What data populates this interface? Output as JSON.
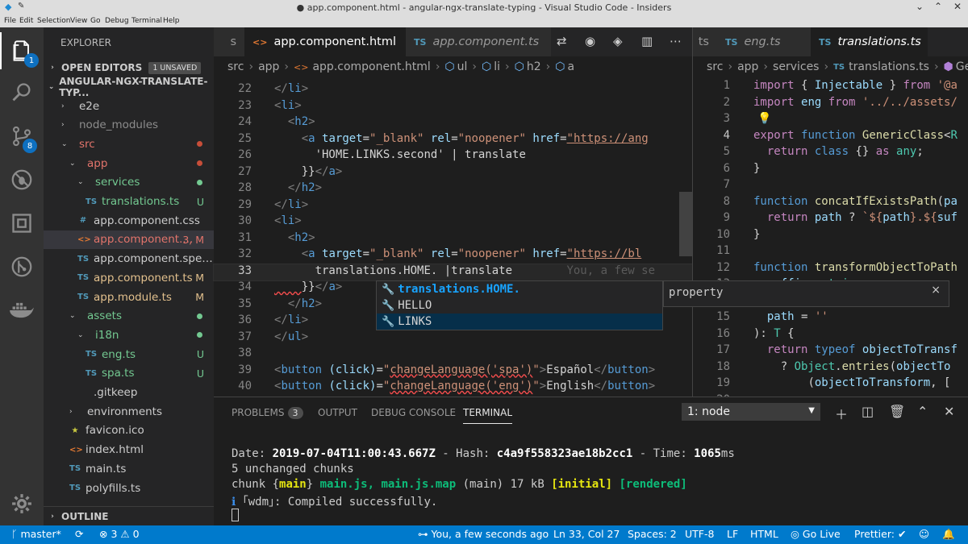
{
  "titlebar": {
    "title": "● app.component.html - angular-ngx-translate-typing - Visual Studio Code - Insiders"
  },
  "menubar": [
    "File",
    "Edit",
    "Selection",
    "View",
    "Go",
    "Debug",
    "Terminal",
    "Help"
  ],
  "activity": {
    "explorer_badge": "1",
    "scm_badge": "8"
  },
  "sidebar": {
    "header": "EXPLORER",
    "open_editors": "OPEN EDITORS",
    "unsaved": "1 UNSAVED",
    "project": "ANGULAR-NGX-TRANSLATE-TYP...",
    "outline": "OUTLINE",
    "items": [
      {
        "label": "e2e",
        "icon": "›",
        "ind": 0,
        "color": "#cccccc",
        "status": "",
        "dot": ""
      },
      {
        "label": "node_modules",
        "icon": "›",
        "ind": 0,
        "color": "#8c8c8c",
        "status": "",
        "dot": ""
      },
      {
        "label": "src",
        "icon": "⌄",
        "ind": 0,
        "color": "#e2746b",
        "status": "",
        "dot": "#c74e39"
      },
      {
        "label": "app",
        "icon": "⌄",
        "ind": 1,
        "color": "#e2746b",
        "status": "",
        "dot": "#c74e39"
      },
      {
        "label": "services",
        "icon": "⌄",
        "ind": 2,
        "color": "#73c991",
        "status": "",
        "dot": "#73c991"
      },
      {
        "label": "translations.ts",
        "icon": "TS",
        "ind": 3,
        "color": "#73c991",
        "status": "U",
        "dot": ""
      },
      {
        "label": "app.component.css",
        "icon": "#",
        "ind": 2,
        "color": "#cccccc",
        "status": "",
        "dot": ""
      },
      {
        "label": "app.component....",
        "icon": "<>",
        "ind": 2,
        "color": "#e2746b",
        "status": "3, M",
        "dot": ""
      },
      {
        "label": "app.component.spec.ts",
        "icon": "TS",
        "ind": 2,
        "color": "#cccccc",
        "status": "",
        "dot": ""
      },
      {
        "label": "app.component.ts",
        "icon": "TS",
        "ind": 2,
        "color": "#e2c08d",
        "status": "M",
        "dot": ""
      },
      {
        "label": "app.module.ts",
        "icon": "TS",
        "ind": 2,
        "color": "#e2c08d",
        "status": "M",
        "dot": ""
      },
      {
        "label": "assets",
        "icon": "⌄",
        "ind": 1,
        "color": "#73c991",
        "status": "",
        "dot": "#73c991"
      },
      {
        "label": "i18n",
        "icon": "⌄",
        "ind": 2,
        "color": "#73c991",
        "status": "",
        "dot": "#73c991"
      },
      {
        "label": "eng.ts",
        "icon": "TS",
        "ind": 3,
        "color": "#73c991",
        "status": "U",
        "dot": ""
      },
      {
        "label": "spa.ts",
        "icon": "TS",
        "ind": 3,
        "color": "#73c991",
        "status": "U",
        "dot": ""
      },
      {
        "label": ".gitkeep",
        "icon": "",
        "ind": 2,
        "color": "#cccccc",
        "status": "",
        "dot": ""
      },
      {
        "label": "environments",
        "icon": "›",
        "ind": 1,
        "color": "#cccccc",
        "status": "",
        "dot": ""
      },
      {
        "label": "favicon.ico",
        "icon": "★",
        "ind": 1,
        "color": "#cccccc",
        "status": "",
        "dot": ""
      },
      {
        "label": "index.html",
        "icon": "<>",
        "ind": 1,
        "color": "#cccccc",
        "status": "",
        "dot": ""
      },
      {
        "label": "main.ts",
        "icon": "TS",
        "ind": 1,
        "color": "#cccccc",
        "status": "",
        "dot": ""
      },
      {
        "label": "polyfills.ts",
        "icon": "TS",
        "ind": 1,
        "color": "#cccccc",
        "status": "",
        "dot": ""
      }
    ]
  },
  "editor1": {
    "tabs": [
      {
        "label": "s",
        "icon": ""
      },
      {
        "label": "app.component.html",
        "icon": "<>",
        "dirty": "●"
      },
      {
        "label": "app.component.ts",
        "icon": "TS"
      }
    ],
    "breadcrumb": [
      "src",
      "app",
      "app.component.html",
      "ul",
      "li",
      "h2",
      "a"
    ]
  },
  "editor2": {
    "tabs": [
      {
        "label": "ts",
        "icon": ""
      },
      {
        "label": "eng.ts",
        "icon": "TS"
      },
      {
        "label": "translations.ts",
        "icon": "TS",
        "close": "×"
      }
    ],
    "breadcrumb": [
      "src",
      "app",
      "services",
      "translations.ts",
      "Generic"
    ]
  },
  "suggest": {
    "items": [
      "translations.HOME.",
      "HELLO",
      "LINKS"
    ],
    "details": "property",
    "close": "×",
    "blame": "You, a few se"
  },
  "panel": {
    "tabs": [
      "PROBLEMS",
      "OUTPUT",
      "DEBUG CONSOLE",
      "TERMINAL"
    ],
    "problems_count": "3",
    "terminal_select": "1: node",
    "lines": {
      "l1a": "Date: ",
      "l1b": "2019-07-04T11:00:43.667Z",
      "l1c": " - Hash: ",
      "l1d": "c4a9f558323ae18b2cc1",
      "l1e": " - Time: ",
      "l1f": "1065",
      "l1g": "ms",
      "l2": "5 unchanged chunks",
      "l3a": "chunk {",
      "l3b": "main",
      "l3c": "} ",
      "l3d": "main.js, main.js.map",
      "l3e": " (main) 17 kB ",
      "l3f": "[initial]",
      "l3g": " ",
      "l3h": "[rendered]",
      "l4a": "ℹ",
      "l4b": " ｢wdm｣: Compiled successfully."
    }
  },
  "statusbar": {
    "branch": "master*",
    "errors": "3",
    "warnings": "0",
    "blame": "You, a few seconds ago",
    "position": "Ln 33, Col 27",
    "spaces": "Spaces: 2",
    "encoding": "UTF-8",
    "eol": "LF",
    "language": "HTML",
    "golive": "Go Live",
    "prettier": "Prettier: ✔"
  },
  "colors": {
    "statusbar": "#007acc",
    "accent": "#0e70c0"
  }
}
